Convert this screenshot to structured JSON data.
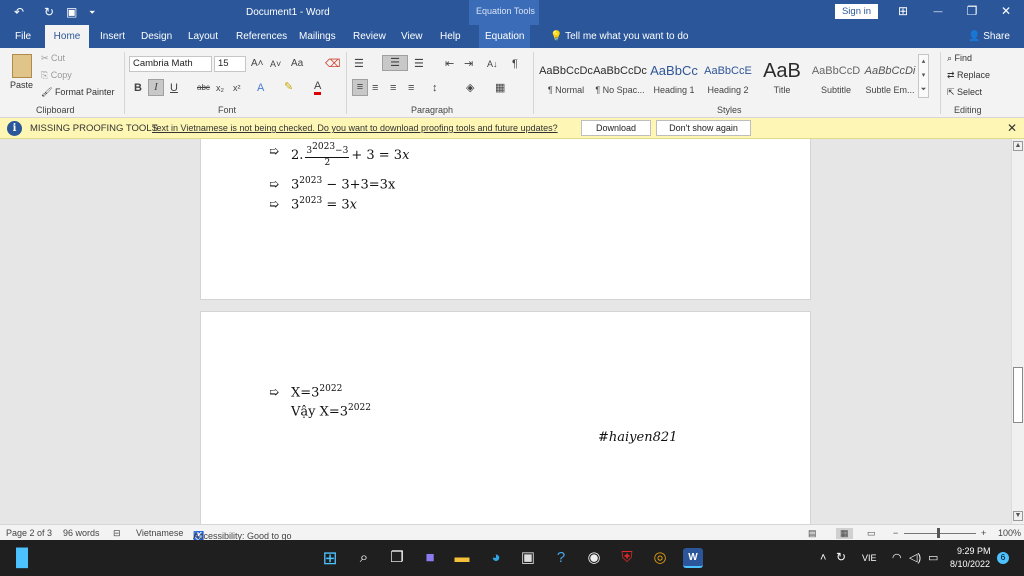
{
  "titlebar": {
    "undo_glyph": "↶",
    "redo_glyph": "↻",
    "save_glyph": "▣",
    "custom_glyph": "⏷",
    "title": "Document1 - Word",
    "context_tab_group": "Equation Tools",
    "sign_in": "Sign in",
    "layout_glyph": "⊞",
    "minimize_glyph": "—",
    "restore_glyph": "❐",
    "close_glyph": "✕"
  },
  "tabs": [
    "File",
    "Home",
    "Insert",
    "Design",
    "Layout",
    "References",
    "Mailings",
    "Review",
    "View",
    "Help",
    "Equation"
  ],
  "active_tab": "Home",
  "tell_me": "Tell me what you want to do",
  "share": "Share",
  "clipboard": {
    "label": "Clipboard",
    "paste": "Paste",
    "cut": "Cut",
    "copy": "Copy",
    "format_painter": "Format Painter"
  },
  "font": {
    "label": "Font",
    "name": "Cambria Math",
    "size": "15",
    "grow": "A˄",
    "shrink": "A˅",
    "case": "Aa",
    "bold": "B",
    "italic": "I",
    "underline": "U",
    "strike": "abc",
    "sub": "x₂",
    "sup": "x²",
    "effects": "A",
    "font_color": "A"
  },
  "paragraph": {
    "label": "Paragraph",
    "pilcrow": "¶",
    "sort": "A↓"
  },
  "styles": {
    "label": "Styles",
    "items": [
      {
        "preview": "AaBbCcDc",
        "name": "¶ Normal"
      },
      {
        "preview": "AaBbCcDc",
        "name": "¶ No Spac..."
      },
      {
        "preview": "AaBbCc",
        "name": "Heading 1"
      },
      {
        "preview": "AaBbCcE",
        "name": "Heading 2"
      },
      {
        "preview": "AaB",
        "name": "Title"
      },
      {
        "preview": "AaBbCcD",
        "name": "Subtitle"
      },
      {
        "preview": "AaBbCcDi",
        "name": "Subtle Em..."
      }
    ]
  },
  "editing": {
    "label": "Editing",
    "find": "Find",
    "replace": "Replace",
    "select": "Select"
  },
  "message_bar": {
    "title": "MISSING PROOFING TOOLS",
    "text": "Text in Vietnamese is not being checked. Do you want to download proofing tools and future updates?",
    "download": "Download",
    "dont_show": "Don't show again",
    "close": "✕"
  },
  "document": {
    "arrow": "➯",
    "line1": {
      "prefix": "2.",
      "frac_num_base": "3",
      "frac_num_exp": "2023",
      "frac_num_tail": "−3",
      "frac_den": "2",
      "rest": "+ 3 = 3",
      "var": "x"
    },
    "line2": {
      "base": "3",
      "exp": "2023",
      "rest": " − 3+3=3x"
    },
    "line3": {
      "base": "3",
      "exp": "2023",
      "rest": " = 3",
      "var": "x"
    },
    "line4": {
      "text": "X=3",
      "exp": "2022"
    },
    "line5": {
      "text": "Vậy X=3",
      "exp": "2022"
    },
    "signature": "#haiyen821"
  },
  "statusbar": {
    "page": "Page 2 of 3",
    "words": "96 words",
    "language": "Vietnamese",
    "accessibility": "Accessibility: Good to go",
    "zoom": "100%",
    "zoom_level": 1.0
  },
  "taskbar": {
    "language": "VIE",
    "time": "9:29 PM",
    "date": "8/10/2022",
    "notifications": "6"
  }
}
